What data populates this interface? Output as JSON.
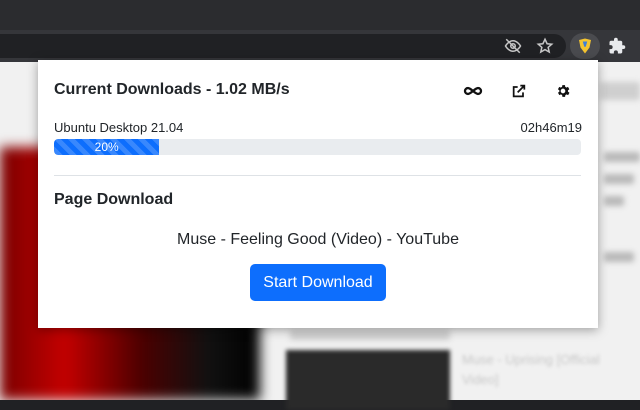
{
  "browser": {
    "toolbar_icons": [
      "eye-off-icon",
      "star-icon",
      "extension-downloader-icon",
      "puzzle-icon"
    ],
    "accent_extension": "#f4c430"
  },
  "popup": {
    "header": {
      "title": "Current Downloads - 1.02 MB/s",
      "icons": [
        "infinity-icon",
        "open-external-icon",
        "gear-icon"
      ]
    },
    "download": {
      "name": "Ubuntu Desktop 21.04",
      "eta": "02h46m19",
      "progress_label": "20%",
      "progress_fraction": 0.2,
      "bar_color": "#0d6efd"
    },
    "page_download": {
      "section_title": "Page Download",
      "page_title": "Muse - Feeling Good (Video) - YouTube",
      "button_label": "Start Download"
    }
  },
  "background_page": {
    "video_title": "Muse - Uprising [Official Video]"
  }
}
